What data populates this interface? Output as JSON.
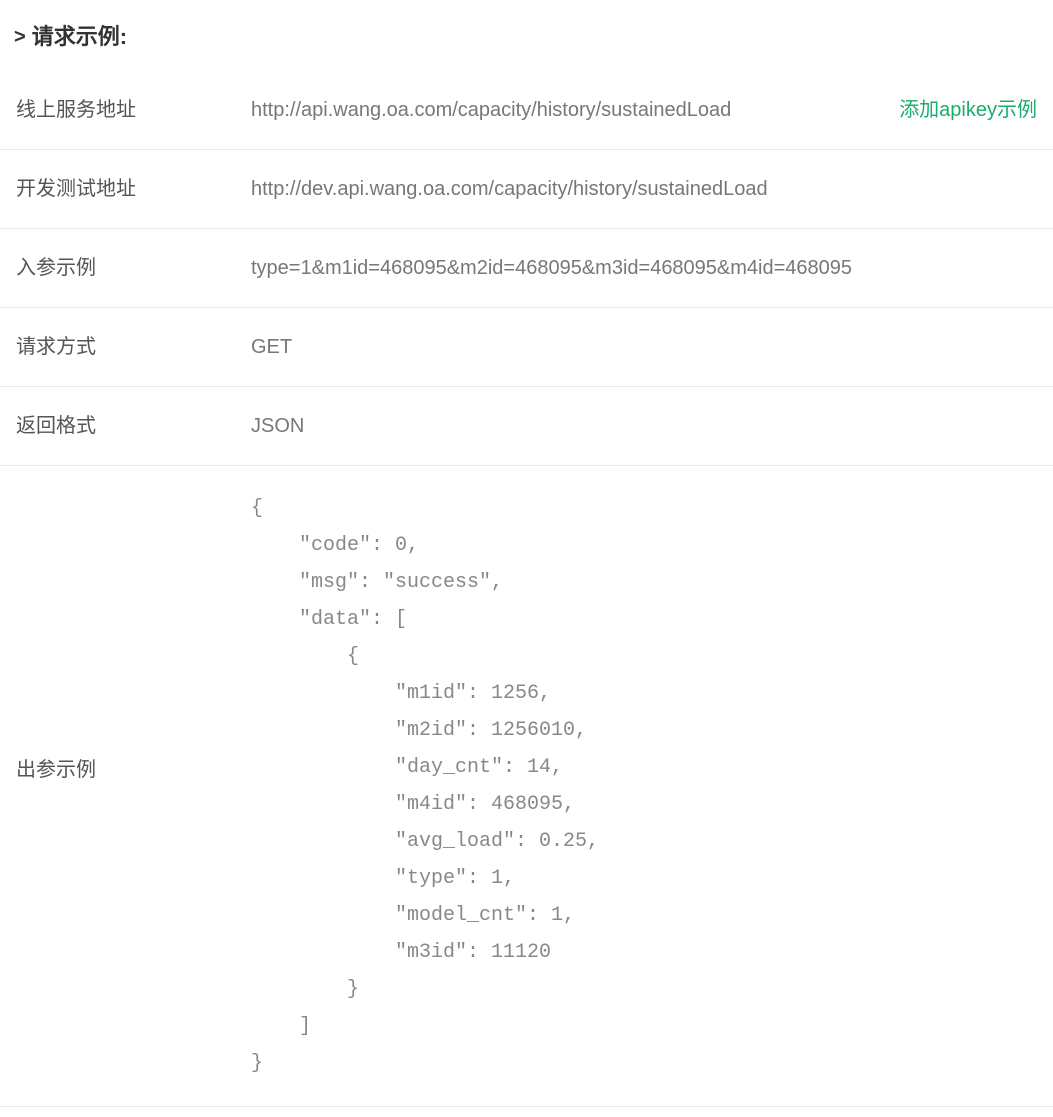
{
  "section": {
    "title": "请求示例:"
  },
  "rows": {
    "prodUrl": {
      "label": "线上服务地址",
      "value": "http://api.wang.oa.com/capacity/history/sustainedLoad",
      "action": "添加apikey示例"
    },
    "devUrl": {
      "label": "开发测试地址",
      "value": "http://dev.api.wang.oa.com/capacity/history/sustainedLoad"
    },
    "inputExample": {
      "label": "入参示例",
      "value": "type=1&m1id=468095&m2id=468095&m3id=468095&m4id=468095"
    },
    "method": {
      "label": "请求方式",
      "value": "GET"
    },
    "responseFormat": {
      "label": "返回格式",
      "value": "JSON"
    },
    "outputExample": {
      "label": "出参示例",
      "value": "{\n    \"code\": 0,\n    \"msg\": \"success\",\n    \"data\": [\n        {\n            \"m1id\": 1256,\n            \"m2id\": 1256010,\n            \"day_cnt\": 14,\n            \"m4id\": 468095,\n            \"avg_load\": 0.25,\n            \"type\": 1,\n            \"model_cnt\": 1,\n            \"m3id\": 11120\n        }\n    ]\n}"
    }
  }
}
